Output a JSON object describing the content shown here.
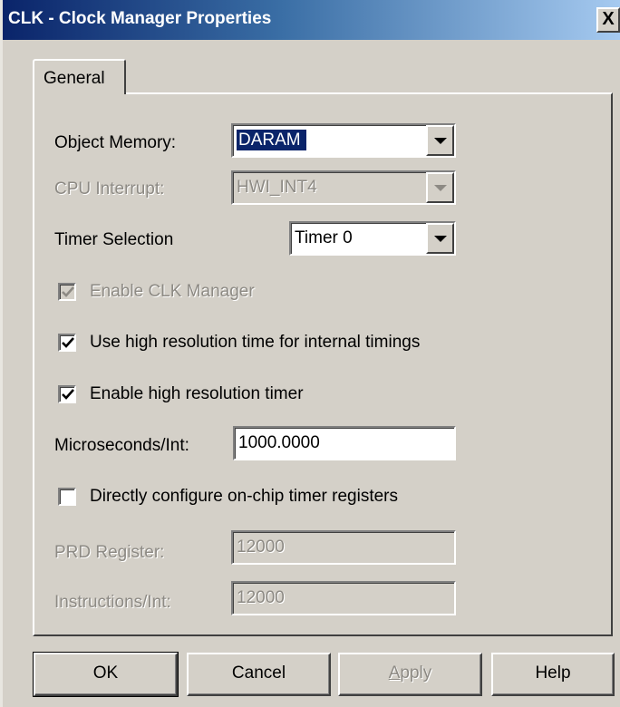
{
  "window": {
    "title": "CLK - Clock Manager Properties",
    "close_glyph": "X"
  },
  "tabs": [
    {
      "label": "General",
      "active": true
    }
  ],
  "form": {
    "object_memory": {
      "label": "Object Memory:",
      "value": "DARAM",
      "selected": true
    },
    "cpu_interrupt": {
      "label": "CPU Interrupt:",
      "value": "HWI_INT4",
      "disabled": true
    },
    "timer_selection": {
      "label": "Timer Selection",
      "value": "Timer 0"
    },
    "enable_clk_manager": {
      "label": "Enable CLK Manager",
      "checked": true,
      "disabled": true
    },
    "use_high_resolution": {
      "label": "Use high resolution time for internal timings",
      "checked": true
    },
    "enable_high_resolution_timer": {
      "label": "Enable high resolution timer",
      "checked": true
    },
    "microseconds_per_int": {
      "label": "Microseconds/Int:",
      "value": "1000.0000"
    },
    "directly_configure": {
      "label": "Directly configure on-chip timer registers",
      "checked": false
    },
    "prd_register": {
      "label": "PRD Register:",
      "value": "12000",
      "disabled": true
    },
    "instructions_per_int": {
      "label": "Instructions/Int:",
      "value": "12000",
      "disabled": true
    }
  },
  "buttons": {
    "ok": "OK",
    "cancel": "Cancel",
    "apply": "Apply",
    "help": "Help"
  },
  "colors": {
    "face": "#d4d0c8",
    "title_start": "#0a246a",
    "title_end": "#a6caf0",
    "disabled_text": "#8d8a84",
    "selection": "#0a246a"
  }
}
